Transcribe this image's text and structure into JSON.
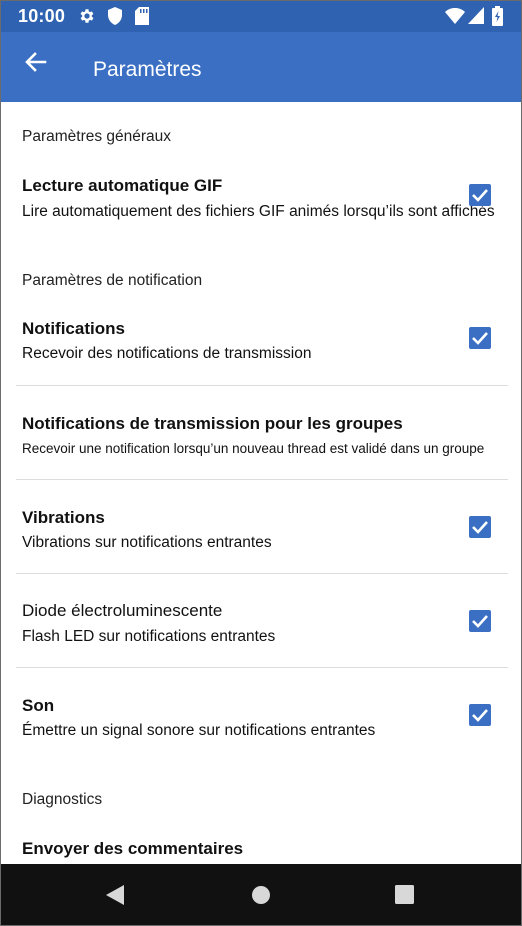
{
  "status_bar": {
    "time": "10:00",
    "icons": [
      "gear-icon",
      "shield-icon",
      "sd-card-icon",
      "wifi-icon",
      "signal-icon",
      "battery-icon"
    ]
  },
  "app_bar": {
    "title": "Paramètres",
    "back_icon": "arrow-left-icon"
  },
  "sections": {
    "general": {
      "header": "Paramètres généraux",
      "gif": {
        "title": "Lecture automatique GIF",
        "subtitle": "Lire automatiquement des fichiers GIF animés lorsqu’ils sont affichés",
        "checked": true
      }
    },
    "notifications": {
      "header": "Paramètres de notification",
      "push": {
        "title": "Notifications",
        "subtitle": "Recevoir des notifications de transmission",
        "checked": true
      },
      "groups": {
        "title": "Notifications de transmission pour les groupes",
        "subtitle": "Recevoir une notification lorsqu’un nouveau thread est validé dans un groupe"
      },
      "vibrations": {
        "title": "Vibrations",
        "subtitle": "Vibrations sur notifications entrantes",
        "checked": true
      },
      "led": {
        "title": "Diode électroluminescente",
        "subtitle": "Flash LED sur notifications entrantes",
        "checked": true
      },
      "sound": {
        "title": "Son",
        "subtitle": "Émettre un signal sonore sur notifications entrantes",
        "checked": true
      }
    },
    "diagnostics": {
      "header": "Diagnostics",
      "feedback": {
        "title": "Envoyer des commentaires"
      }
    }
  },
  "nav_bar": {
    "back": "triangle-back-icon",
    "home": "circle-home-icon",
    "recents": "square-recents-icon"
  },
  "colors": {
    "status_bar": "#2f63b1",
    "app_bar": "#3a6fc4",
    "checkbox": "#3a6fc4",
    "nav_bar": "#111111"
  }
}
